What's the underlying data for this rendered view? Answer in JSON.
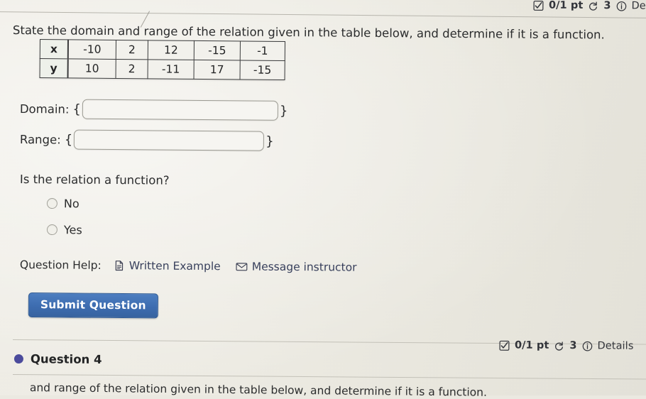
{
  "header": {
    "points": "0/1 pt",
    "attempts": "3",
    "details_label": "Det",
    "check_icon": "checkbox-icon",
    "retry_icon": "retry-icon",
    "info_icon": "info-icon"
  },
  "question": {
    "prompt": "State the domain and range of the relation given in the table below, and determine if it is a function."
  },
  "table": {
    "rows": [
      {
        "variable": "x",
        "values": [
          "-10",
          "2",
          "12",
          "-15",
          "-1"
        ]
      },
      {
        "variable": "y",
        "values": [
          "10",
          "2",
          "-11",
          "17",
          "-15"
        ]
      }
    ]
  },
  "answers": {
    "domain_label": "Domain:",
    "range_label": "Range:",
    "open_brace": "{",
    "close_brace": "}",
    "domain_value": "",
    "range_value": "",
    "domain_placeholder": "",
    "range_placeholder": ""
  },
  "function_question": {
    "prompt": "Is the relation a function?",
    "options": [
      {
        "label": "No",
        "selected": false
      },
      {
        "label": "Yes",
        "selected": false
      }
    ]
  },
  "help": {
    "label": "Question Help:",
    "links": [
      {
        "label": "Written Example",
        "icon": "document-icon"
      },
      {
        "label": "Message instructor",
        "icon": "envelope-icon"
      }
    ]
  },
  "actions": {
    "submit_label": "Submit Question"
  },
  "next_question": {
    "status_points": "0/1 pt",
    "status_attempts": "3",
    "status_details": "Details",
    "title": "Question 4",
    "prompt": "and range of the relation given in the table below, and determine if it is a function."
  },
  "colors": {
    "background": "#ece9e1",
    "text": "#2b2c2d",
    "submit_button": "#3d6cb0",
    "question_dot": "#4b4b9c",
    "link": "#38405c",
    "table_border": "#3a3b3c"
  }
}
